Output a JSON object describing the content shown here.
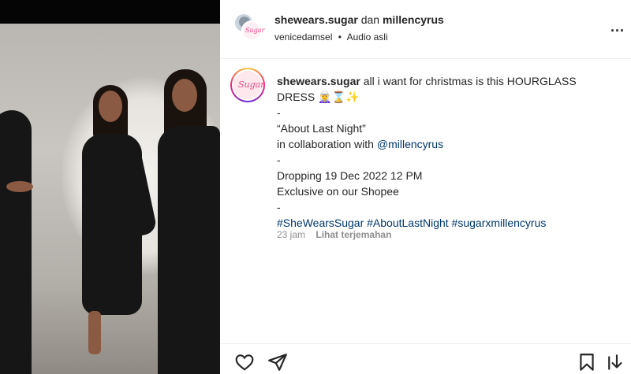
{
  "header": {
    "author": "shewears.sugar",
    "conjunction": "dan",
    "collaborator": "millencyrus",
    "sub_user": "venicedamsel",
    "separator": "•",
    "audio": "Audio asli",
    "more_label": "..."
  },
  "caption": {
    "user": "shewears.sugar",
    "line1": "all i want for christmas is this HOURGLASS DRESS 🧝‍♀️⌛✨",
    "dash1": "-",
    "line2": "“About Last Night”",
    "line3_prefix": "in collaboration with ",
    "mention": "@millencyrus",
    "dash2": "-",
    "line4": "Dropping 19 Dec 2022 12 PM",
    "line5": "Exclusive on our Shopee",
    "dash3": "-",
    "hashtags": "#SheWearsSugar #AboutLastNight #sugarxmillencyrus"
  },
  "meta": {
    "time": "23 jam",
    "translate": "Lihat terjemahan"
  },
  "avatar_logo": "Sugar",
  "icons": [
    "heart-icon",
    "share-icon",
    "bookmark-icon",
    "download-icon",
    "more-icon"
  ]
}
